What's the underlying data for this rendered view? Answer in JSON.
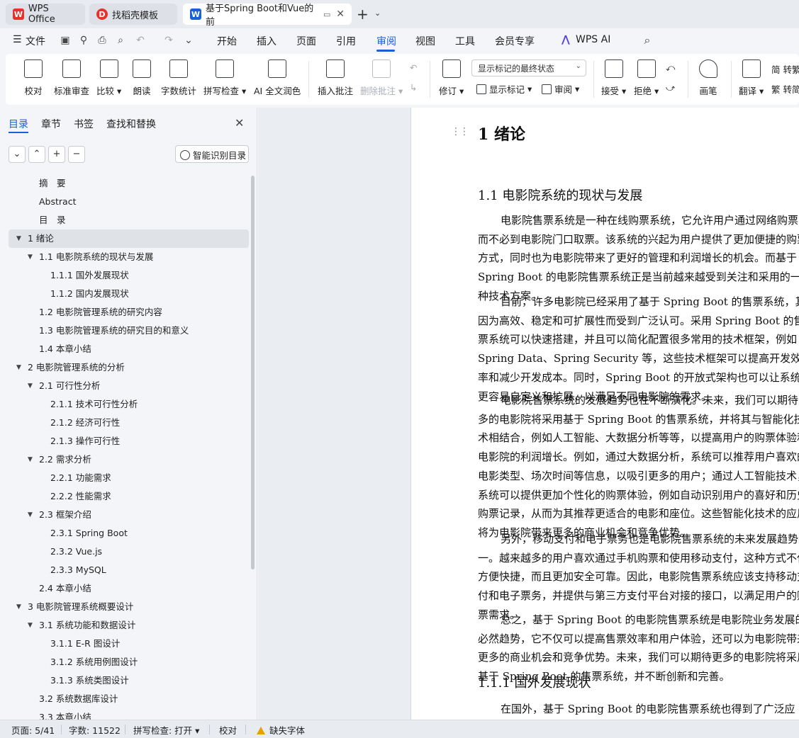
{
  "tabs": [
    {
      "label": "WPS Office",
      "icon": "wps-logo-icon"
    },
    {
      "label": "找稻壳模板",
      "icon": "docer-logo-icon"
    },
    {
      "label": "基于Spring Boot和Vue的前",
      "icon": "word-doc-icon"
    }
  ],
  "menu": {
    "file": "文件",
    "items": [
      "开始",
      "插入",
      "页面",
      "引用",
      "审阅",
      "视图",
      "工具",
      "会员专享"
    ],
    "active": "审阅",
    "wps_ai": "WPS AI"
  },
  "ribbon": {
    "proofread": "校对",
    "standard_review": "标准审查",
    "compare": "比较",
    "read_aloud": "朗读",
    "word_count": "字数统计",
    "spell_check": "拼写检查",
    "ai_polish": "AI 全文润色",
    "insert_comment": "插入批注",
    "delete_comment": "删除批注",
    "track_changes": "修订",
    "markup_select": "显示标记的最终状态",
    "show_markup": "显示标记",
    "review": "审阅",
    "accept": "接受",
    "reject": "拒绝",
    "pen": "画笔",
    "translate": "翻译",
    "simp_trad_1": "简 转繁",
    "simp_trad_2": "繁 转简"
  },
  "nav": {
    "tabs": [
      "目录",
      "章节",
      "书签",
      "查找和替换"
    ],
    "smart_toc": "智能识别目录",
    "toc": [
      {
        "label": "摘　要",
        "level": 1,
        "arrow": false
      },
      {
        "label": "Abstract",
        "level": 1,
        "arrow": false
      },
      {
        "label": "目　录",
        "level": 1,
        "arrow": false
      },
      {
        "label": "1  绪论",
        "level": 0,
        "arrow": true,
        "selected": true
      },
      {
        "label": "1.1  电影院系统的现状与发展",
        "level": 1,
        "arrow": true
      },
      {
        "label": "1.1.1  国外发展现状",
        "level": 2,
        "arrow": false
      },
      {
        "label": "1.1.2  国内发展现状",
        "level": 2,
        "arrow": false
      },
      {
        "label": "1.2 电影院管理系统的研究内容",
        "level": 1,
        "arrow": false
      },
      {
        "label": "1.3  电影院管理系统的研究目的和意义",
        "level": 1,
        "arrow": false
      },
      {
        "label": "1.4  本章小结",
        "level": 1,
        "arrow": false
      },
      {
        "label": "2  电影院管理系统的分析",
        "level": 0,
        "arrow": true
      },
      {
        "label": "2.1  可行性分析",
        "level": 1,
        "arrow": true
      },
      {
        "label": "2.1.1  技术可行性分析",
        "level": 2,
        "arrow": false
      },
      {
        "label": "2.1.2  经济可行性",
        "level": 2,
        "arrow": false
      },
      {
        "label": "2.1.3  操作可行性",
        "level": 2,
        "arrow": false
      },
      {
        "label": "2.2  需求分析",
        "level": 1,
        "arrow": true
      },
      {
        "label": "2.2.1  功能需求",
        "level": 2,
        "arrow": false
      },
      {
        "label": "2.2.2  性能需求",
        "level": 2,
        "arrow": false
      },
      {
        "label": "2.3  框架介绍",
        "level": 1,
        "arrow": true
      },
      {
        "label": "2.3.1 Spring Boot",
        "level": 2,
        "arrow": false
      },
      {
        "label": "2.3.2 Vue.js",
        "level": 2,
        "arrow": false
      },
      {
        "label": "2.3.3 MySQL",
        "level": 2,
        "arrow": false
      },
      {
        "label": "2.4  本章小结",
        "level": 1,
        "arrow": false
      },
      {
        "label": "3  电影院管理系统概要设计",
        "level": 0,
        "arrow": true
      },
      {
        "label": "3.1  系统功能和数据设计",
        "level": 1,
        "arrow": true
      },
      {
        "label": "3.1.1 E-R 图设计",
        "level": 2,
        "arrow": false
      },
      {
        "label": "3.1.2  系统用例图设计",
        "level": 2,
        "arrow": false
      },
      {
        "label": "3.1.3  系统类图设计",
        "level": 2,
        "arrow": false
      },
      {
        "label": "3.2  系统数据库设计",
        "level": 1,
        "arrow": false
      },
      {
        "label": "3.3  本章小结",
        "level": 1,
        "arrow": false
      }
    ]
  },
  "doc": {
    "h1": "1  绪论",
    "h2_1": "1.1  电影院系统的现状与发展",
    "p1": "电影院售票系统是一种在线购票系统，它允许用户通过网络购票，而不必到电影院门口取票。该系统的兴起为用户提供了更加便捷的购票方式，同时也为电影院带来了更好的管理和利润增长的机会。而基于 Spring Boot 的电影院售票系统正是当前越来越受到关注和采用的一种技术方案。",
    "p2": "目前，许多电影院已经采用了基于 Spring Boot 的售票系统，其因为高效、稳定和可扩展性而受到广泛认可。采用 Spring Boot 的售票系统可以快速搭建，并且可以简化配置很多常用的技术框架，例如 Spring Data、Spring Security 等，这些技术框架可以提高开发效率和减少开发成本。同时，Spring Boot 的开放式架构也可以让系统更容易自定义和扩展，以满足不同电影院的需求。",
    "p3": "电影院售票系统的发展趋势也在不断演化。未来，我们可以期待更多的电影院将采用基于 Spring Boot 的售票系统，并将其与智能化技术相结合，例如人工智能、大数据分析等等，以提高用户的购票体验和电影院的利润增长。例如，通过大数据分析，系统可以推荐用户喜欢的电影类型、场次时间等信息，以吸引更多的用户；通过人工智能技术，系统可以提供更加个性化的购票体验，例如自动识别用户的喜好和历史购票记录，从而为其推荐更适合的电影和座位。这些智能化技术的应用将为电影院带来更多的商业机会和竞争优势。",
    "p4": "另外，移动支付和电子票务也是电影院售票系统的未来发展趋势之一。越来越多的用户喜欢通过手机购票和使用移动支付，这种方式不仅方便快捷，而且更加安全可靠。因此，电影院售票系统应该支持移动支付和电子票务，并提供与第三方支付平台对接的接口，以满足用户的购票需求。",
    "p5": "总之，基于 Spring Boot 的电影院售票系统是电影院业务发展的必然趋势，它不仅可以提高售票效率和用户体验，还可以为电影院带来更多的商业机会和竞争优势。未来，我们可以期待更多的电影院将采用基于 Spring Boot 的售票系统，并不断创新和完善。",
    "h3": "1.1.1  国外发展现状",
    "p6": "在国外，基于 Spring Boot 的电影院售票系统也得到了广泛应用。"
  },
  "status": {
    "page": "页面: 5/41",
    "words": "字数: 11522",
    "spell": "拼写检查: 打开",
    "proof": "校对",
    "missing_font": "缺失字体"
  },
  "colors": {
    "accent": "#1a5fd8",
    "wps_red": "#e5322d",
    "warning": "#e6a100"
  }
}
